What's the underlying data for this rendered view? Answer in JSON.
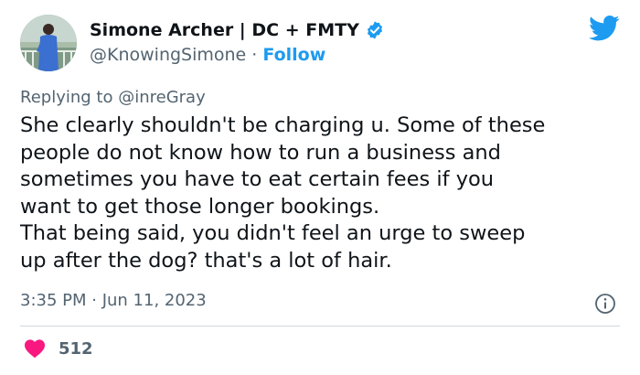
{
  "author": {
    "display_name": "Simone Archer | DC + FMTY",
    "handle": "@KnowingSimone",
    "separator": " · ",
    "follow_label": "Follow",
    "verified": true
  },
  "reply": {
    "prefix": "Replying to ",
    "to_handle": "@inreGray"
  },
  "tweet": {
    "lines": [
      "She clearly shouldn't be charging u. Some of these",
      "people do not know how to run a business and",
      "sometimes you have to eat certain fees if you",
      "want to get those longer bookings.",
      "That being said, you didn't feel an urge to sweep",
      "up after the dog? that's a lot of hair."
    ]
  },
  "meta": {
    "timestamp": "3:35 PM · Jun 11, 2023"
  },
  "engagement": {
    "likes": "512"
  },
  "colors": {
    "accent": "#1d9bf0",
    "heart": "#f91880",
    "muted": "#536471",
    "text": "#0f1419"
  },
  "icons": {
    "brand": "twitter-bird-icon",
    "verified": "verified-badge-icon",
    "info": "info-icon",
    "like": "heart-icon"
  }
}
